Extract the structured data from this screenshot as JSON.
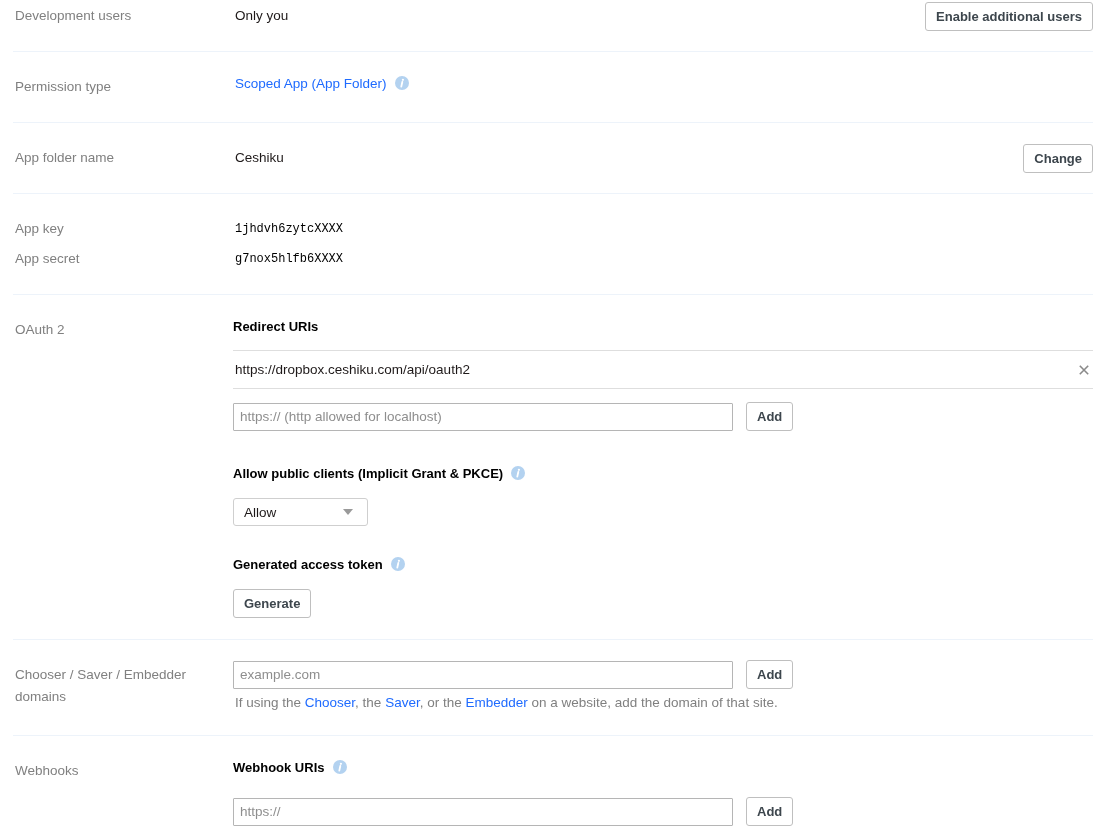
{
  "settings": [
    {
      "kind": "field",
      "label": "Development users",
      "blocks": [
        {
          "kind": "value",
          "text": "Only you"
        }
      ],
      "action": "Enable additional users"
    },
    {
      "kind": "field",
      "label": "Permission type",
      "blocks": [
        {
          "kind": "link",
          "text": "Scoped App (App Folder)",
          "info": true
        }
      ]
    },
    {
      "kind": "field",
      "label": "App folder name",
      "blocks": [
        {
          "kind": "value",
          "text": "Ceshiku"
        }
      ],
      "action": "Change"
    },
    {
      "kind": "pairs",
      "pairs": [
        {
          "label": "App key",
          "value": "1jhdvh6zytcXXXX"
        },
        {
          "label": "App secret",
          "value": "g7nox5hlfb6XXXX"
        }
      ]
    },
    {
      "kind": "field",
      "label": "OAuth 2",
      "blocks": [
        {
          "kind": "heading",
          "text": "Redirect URIs"
        },
        {
          "kind": "uri_list",
          "uris": [
            "https://dropbox.ceshiku.com/api/oauth2"
          ]
        },
        {
          "kind": "input_row",
          "placeholder": "https:// (http allowed for localhost)",
          "button": "Add"
        },
        {
          "kind": "heading",
          "text": "Allow public clients (Implicit Grant & PKCE)",
          "info": true
        },
        {
          "kind": "select",
          "value": "Allow"
        },
        {
          "kind": "heading",
          "text": "Generated access token",
          "info": true
        },
        {
          "kind": "button",
          "text": "Generate"
        }
      ]
    },
    {
      "kind": "field",
      "label": "Chooser / Saver / Embedder domains",
      "blocks": [
        {
          "kind": "input_row",
          "placeholder": "example.com",
          "button": "Add"
        },
        {
          "kind": "help",
          "parts": [
            {
              "kind": "text",
              "text": "If using the "
            },
            {
              "kind": "link",
              "text": "Chooser"
            },
            {
              "kind": "text",
              "text": ", the "
            },
            {
              "kind": "link",
              "text": "Saver"
            },
            {
              "kind": "text",
              "text": ", or the "
            },
            {
              "kind": "link",
              "text": "Embedder"
            },
            {
              "kind": "text",
              "text": " on a website, add the domain of that site."
            }
          ]
        }
      ]
    },
    {
      "kind": "field",
      "label": "Webhooks",
      "blocks": [
        {
          "kind": "heading",
          "text": "Webhook URIs",
          "info": true
        },
        {
          "kind": "input_row",
          "placeholder": "https://",
          "button": "Add"
        }
      ]
    }
  ]
}
